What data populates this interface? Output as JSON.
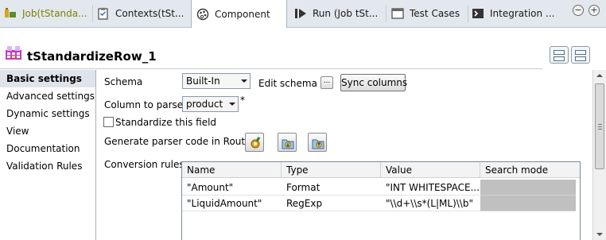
{
  "tabs": [
    {
      "label": "Job(tStanda...",
      "icon": "job-icon"
    },
    {
      "label": "Contexts(tSt...",
      "icon": "contexts-icon"
    },
    {
      "label": "Component",
      "icon": "component-icon"
    },
    {
      "label": "Run (Job tSt...",
      "icon": "run-icon"
    },
    {
      "label": "Test Cases",
      "icon": "test-cases-icon"
    },
    {
      "label": "Integration ...",
      "icon": "integration-icon"
    }
  ],
  "window_controls": {
    "minimize": "−",
    "maximize": "+"
  },
  "component": {
    "title": "tStandardizeRow_1",
    "icon": "component-grid-icon"
  },
  "sidebar": {
    "items": [
      {
        "label": "Basic settings",
        "active": true
      },
      {
        "label": "Advanced settings"
      },
      {
        "label": "Dynamic settings"
      },
      {
        "label": "View"
      },
      {
        "label": "Documentation"
      },
      {
        "label": "Validation Rules"
      }
    ]
  },
  "form": {
    "schema_label": "Schema",
    "schema_value": "Built-In",
    "edit_schema_label": "Edit schema",
    "edit_schema_button": "...",
    "sync_columns_button": "Sync columns",
    "column_to_parse_label": "Column to parse",
    "column_to_parse_value": "product",
    "required_marker": "*",
    "standardize_field_label": "Standardize this field",
    "standardize_field_checked": false,
    "generate_parser_label": "Generate parser code in Routines",
    "conversion_rules_label": "Conversion rules"
  },
  "rules_table": {
    "headers": [
      "Name",
      "Type",
      "Value",
      "Search mode"
    ],
    "rows": [
      [
        "\"Amount\"",
        "Format",
        "\"INT WHITESPACE...",
        ""
      ],
      [
        "\"LiquidAmount\"",
        "RegExp",
        "\"\\\\d+\\\\s*(L|ML)\\\\b\"",
        ""
      ]
    ]
  },
  "colors": {
    "tab_bar": "#e3e8ee",
    "active_sidebar": "#dfe4ea",
    "search_mode_cell": "#c0c0c0",
    "first_tab_text": "#808000"
  }
}
